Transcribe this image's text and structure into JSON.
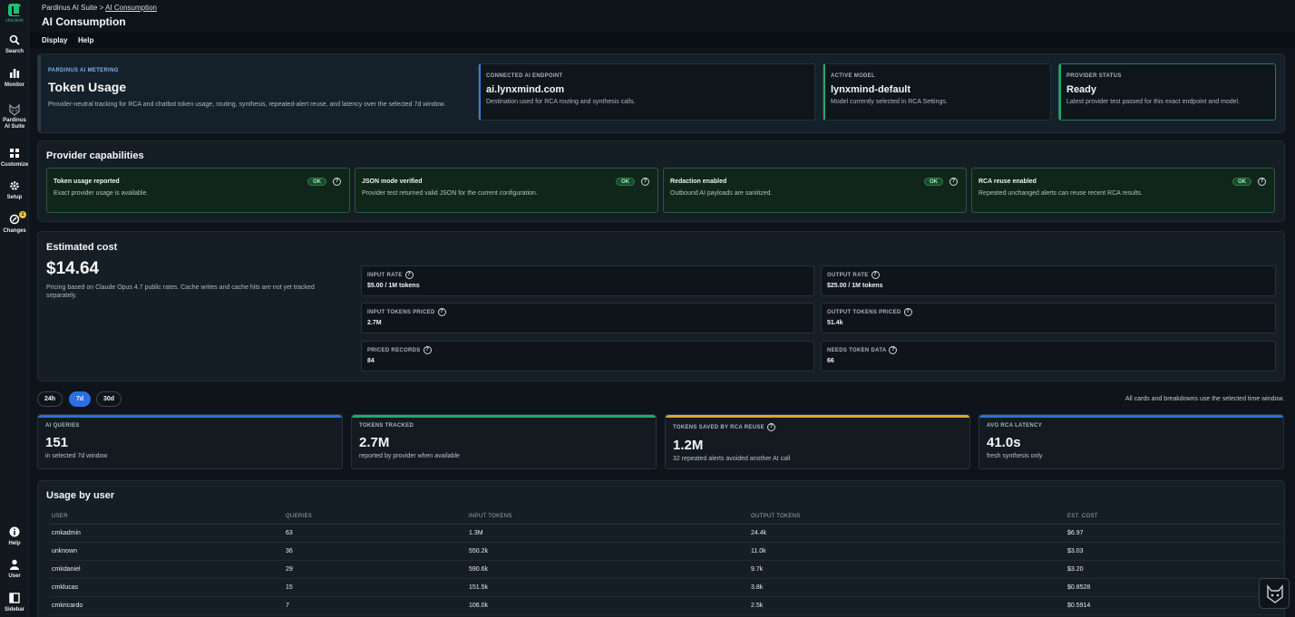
{
  "app": {
    "logo_text": "checkmk"
  },
  "sidebar": {
    "top_items": [
      {
        "label": "Search",
        "icon": "search-icon"
      },
      {
        "label": "Monitor",
        "icon": "bar-chart-icon"
      },
      {
        "label": "Pardinus AI Suite",
        "icon": "cat-icon"
      },
      {
        "label": "Customize",
        "icon": "grid-icon"
      },
      {
        "label": "Setup",
        "icon": "gear-icon"
      },
      {
        "label": "Changes",
        "icon": "changes-icon",
        "badge": "1"
      }
    ],
    "bottom_items": [
      {
        "label": "Help",
        "icon": "info-icon"
      },
      {
        "label": "User",
        "icon": "user-icon"
      },
      {
        "label": "Sidebar",
        "icon": "sidebar-icon"
      }
    ]
  },
  "header": {
    "breadcrumb": {
      "root": "Pardinus AI Suite",
      "sep": ">",
      "current": "AI Consumption"
    },
    "title": "AI Consumption",
    "menu": [
      "Display",
      "Help"
    ]
  },
  "hero": {
    "eyebrow": "PARDINUS AI METERING",
    "title": "Token Usage",
    "desc": "Provider-neutral tracking for RCA and chatbot token usage, routing, synthesis, repeated-alert reuse, and latency over the selected 7d window.",
    "cards": [
      {
        "label": "CONNECTED AI ENDPOINT",
        "value": "ai.lynxmind.com",
        "desc": "Destination used for RCA routing and synthesis calls.",
        "accent": "#3b7be8"
      },
      {
        "label": "ACTIVE MODEL",
        "value": "lynxmind-default",
        "desc": "Model currently selected in RCA Settings.",
        "accent": "#23a86b"
      },
      {
        "label": "PROVIDER STATUS",
        "value": "Ready",
        "desc": "Latest provider test passed for this exact endpoint and model.",
        "accent": "#23a86b"
      }
    ]
  },
  "capabilities": {
    "title": "Provider capabilities",
    "items": [
      {
        "title": "Token usage reported",
        "desc": "Exact provider usage is available.",
        "status": "OK"
      },
      {
        "title": "JSON mode verified",
        "desc": "Provider test returned valid JSON for the current configuration.",
        "status": "OK"
      },
      {
        "title": "Redaction enabled",
        "desc": "Outbound AI payloads are sanitized.",
        "status": "OK"
      },
      {
        "title": "RCA reuse enabled",
        "desc": "Repeated unchanged alerts can reuse recent RCA results.",
        "status": "OK"
      }
    ]
  },
  "cost": {
    "title": "Estimated cost",
    "amount": "$14.64",
    "note": "Pricing based on Claude Opus 4.7 public rates. Cache writes and cache hits are not yet tracked separately.",
    "rates": [
      {
        "label": "INPUT RATE",
        "value": "$5.00 / 1M tokens"
      },
      {
        "label": "OUTPUT RATE",
        "value": "$25.00 / 1M tokens"
      },
      {
        "label": "INPUT TOKENS PRICED",
        "value": "2.7M"
      },
      {
        "label": "OUTPUT TOKENS PRICED",
        "value": "51.4k"
      },
      {
        "label": "PRICED RECORDS",
        "value": "84"
      },
      {
        "label": "NEEDS TOKEN DATA",
        "value": "66"
      }
    ]
  },
  "time_tabs": {
    "options": [
      "24h",
      "7d",
      "30d"
    ],
    "selected": "7d",
    "note": "All cards and breakdowns use the selected time window."
  },
  "stats": [
    {
      "label": "AI QUERIES",
      "value": "151",
      "sub": "in selected 7d window",
      "accent": "#2f6fd8",
      "help": false
    },
    {
      "label": "TOKENS TRACKED",
      "value": "2.7M",
      "sub": "reported by provider when available",
      "accent": "#23a86b",
      "help": false
    },
    {
      "label": "TOKENS SAVED BY RCA REUSE",
      "value": "1.2M",
      "sub": "32 repeated alerts avoided another AI call",
      "accent": "#d8a72b",
      "help": true
    },
    {
      "label": "AVG RCA LATENCY",
      "value": "41.0s",
      "sub": "fresh synthesis only",
      "accent": "#2f6fd8",
      "help": false
    }
  ],
  "usage": {
    "title": "Usage by user",
    "columns": [
      "USER",
      "QUERIES",
      "INPUT TOKENS",
      "OUTPUT TOKENS",
      "EST. COST"
    ],
    "rows": [
      [
        "cmkadmin",
        "63",
        "1.3M",
        "24.4k",
        "$6.97"
      ],
      [
        "unknown",
        "36",
        "550.2k",
        "11.0k",
        "$3.03"
      ],
      [
        "cmkdaniel",
        "29",
        "590.6k",
        "9.7k",
        "$3.20"
      ],
      [
        "cmklucas",
        "15",
        "151.5k",
        "3.8k",
        "$0.8528"
      ],
      [
        "cmkricardo",
        "7",
        "106.0k",
        "2.5k",
        "$0.5914"
      ]
    ]
  }
}
